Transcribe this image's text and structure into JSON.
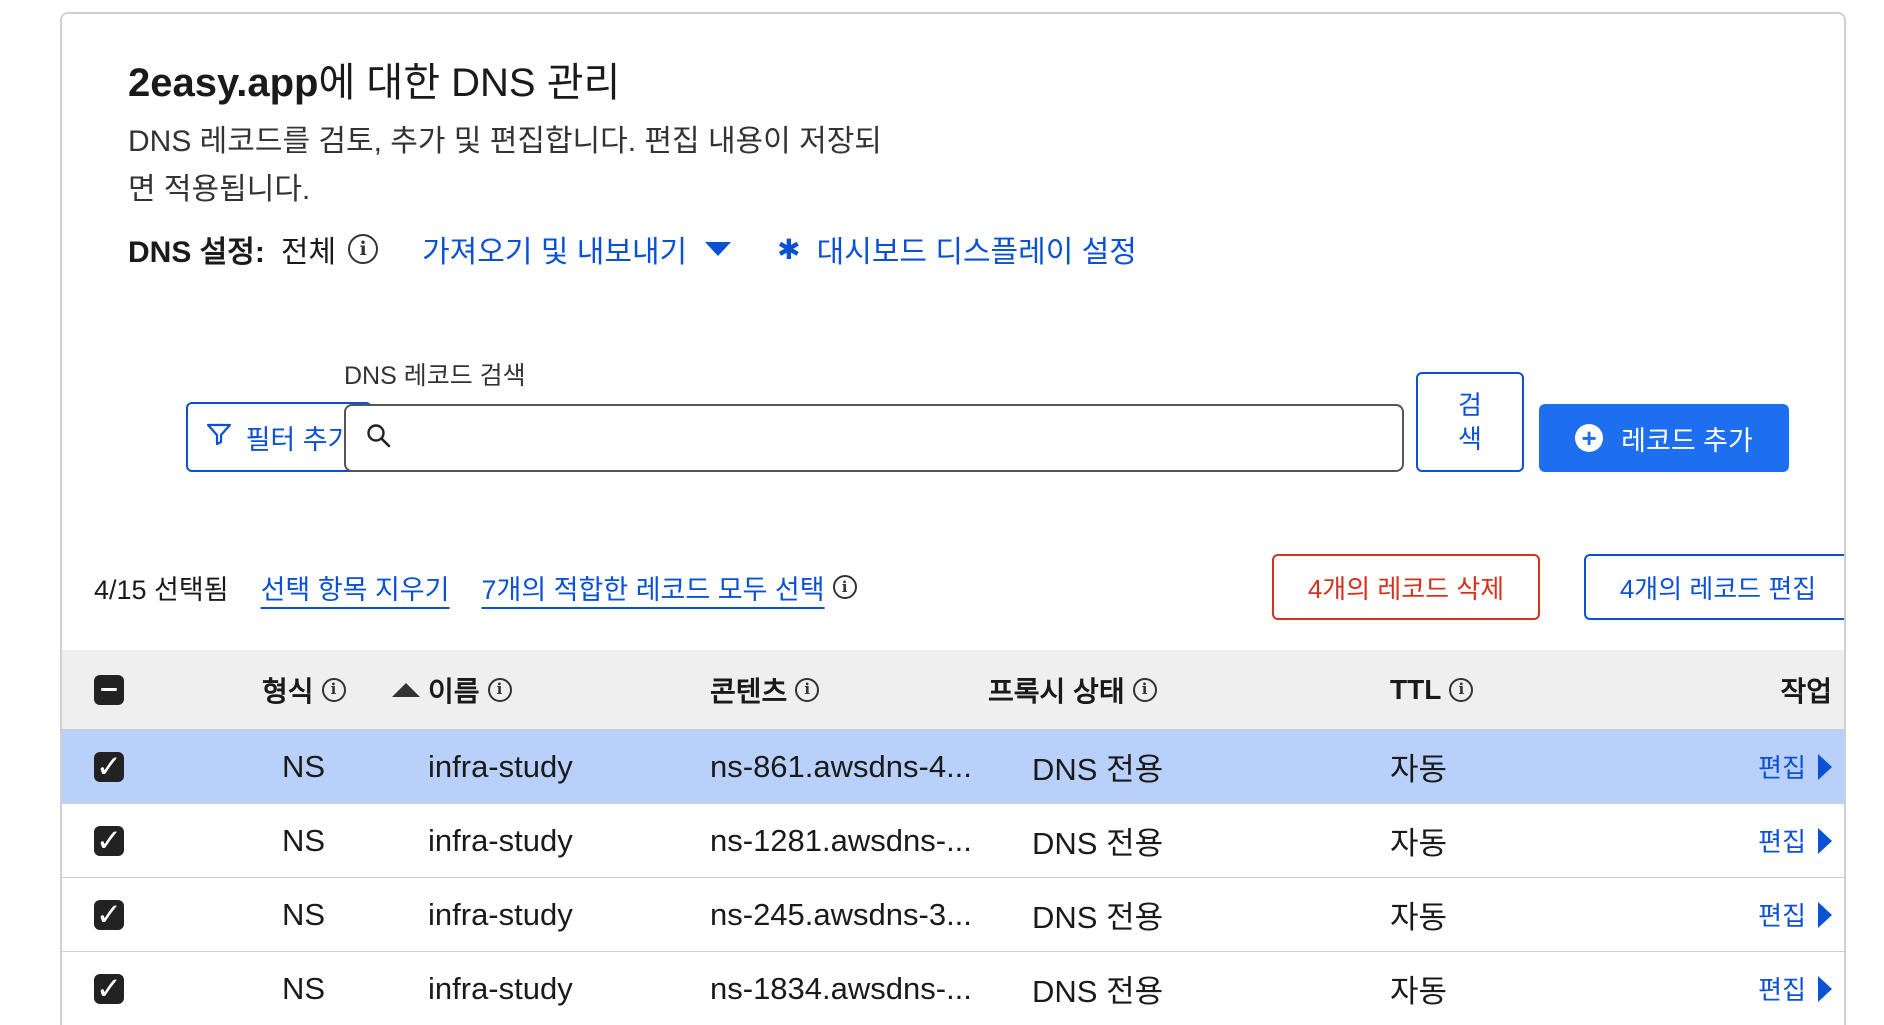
{
  "header": {
    "title_domain": "2easy.app",
    "title_suffix": "에 대한 DNS 관리",
    "description": "DNS 레코드를 검토, 추가 및 편집합니다. 편집 내용이 저장되면 적용됩니다."
  },
  "settings": {
    "label": "DNS 설정:",
    "value": "전체",
    "import_export": "가져오기 및 내보내기",
    "dashboard_settings": "대시보드 디스플레이 설정"
  },
  "search": {
    "label": "DNS 레코드 검색",
    "placeholder": "",
    "filter_button": "필터 추가",
    "search_button": "검색",
    "add_record_button": "레코드 추가"
  },
  "selection": {
    "count": "4/15 선택됨",
    "clear_link": "선택 항목 지우기",
    "select_all_link": "7개의 적합한 레코드 모두 선택",
    "delete_button": "4개의 레코드 삭제",
    "edit_button": "4개의 레코드 편집"
  },
  "table": {
    "headers": {
      "type": "형식",
      "name": "이름",
      "content": "콘텐츠",
      "proxy": "프록시 상태",
      "ttl": "TTL",
      "action": "작업"
    },
    "rows": [
      {
        "type": "NS",
        "name": "infra-study",
        "content": "ns-861.awsdns-4...",
        "proxy": "DNS 전용",
        "ttl": "자동",
        "action": "편집",
        "selected": true
      },
      {
        "type": "NS",
        "name": "infra-study",
        "content": "ns-1281.awsdns-...",
        "proxy": "DNS 전용",
        "ttl": "자동",
        "action": "편집",
        "selected": false
      },
      {
        "type": "NS",
        "name": "infra-study",
        "content": "ns-245.awsdns-3...",
        "proxy": "DNS 전용",
        "ttl": "자동",
        "action": "편집",
        "selected": false
      },
      {
        "type": "NS",
        "name": "infra-study",
        "content": "ns-1834.awsdns-...",
        "proxy": "DNS 전용",
        "ttl": "자동",
        "action": "편집",
        "selected": false
      }
    ]
  },
  "colors": {
    "accent": "#0a51d4",
    "primary_button": "#1e6ef0",
    "danger": "#d6311c",
    "row_highlight": "#b8d0fa"
  },
  "icons": {
    "info": "info-icon",
    "caret_down": "caret-down-icon",
    "gear": "gear-icon",
    "filter": "filter-icon",
    "search": "search-icon",
    "plus": "plus-circle-icon",
    "sort": "sort-ascending-icon",
    "checkbox": "checkbox-checked-icon",
    "edit_caret": "caret-right-icon"
  }
}
